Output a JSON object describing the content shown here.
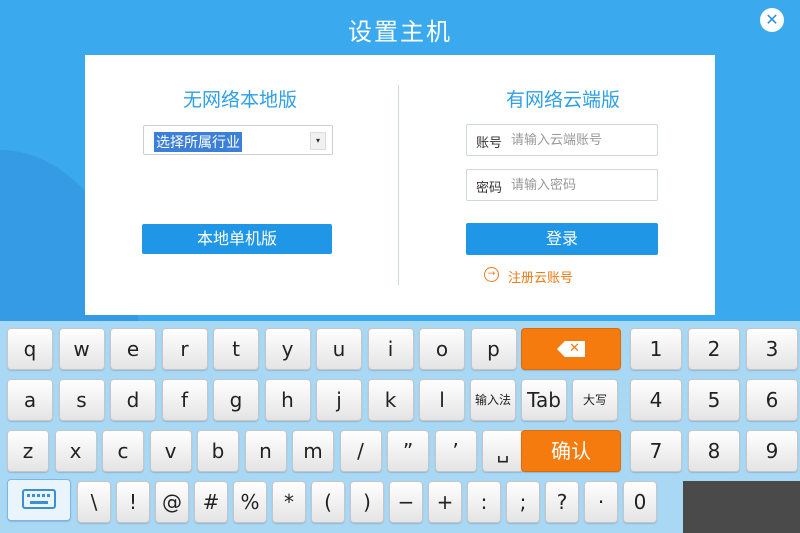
{
  "title": "设置主机",
  "left": {
    "heading": "无网络本地版",
    "industry_select": "选择所属行业",
    "local_button": "本地单机版"
  },
  "right": {
    "heading": "有网络云端版",
    "account_label": "账号",
    "account_placeholder": "请输入云端账号",
    "password_label": "密码",
    "password_placeholder": "请输入密码",
    "login_button": "登录",
    "register_link": "注册云账号"
  },
  "keyboard": {
    "row1": [
      "q",
      "w",
      "e",
      "r",
      "t",
      "y",
      "u",
      "i",
      "o",
      "p"
    ],
    "row2": [
      "a",
      "s",
      "d",
      "f",
      "g",
      "h",
      "j",
      "k",
      "l"
    ],
    "row2_extra": [
      "输入法",
      "Tab",
      "大写"
    ],
    "row3": [
      "z",
      "x",
      "c",
      "v",
      "b",
      "n",
      "m",
      "/",
      "”",
      "’",
      "␣"
    ],
    "confirm": "确认",
    "row4": [
      "\\",
      "!",
      "@",
      "#",
      "%",
      "*",
      "(",
      ")",
      "−",
      "+",
      ":",
      ";",
      "?",
      "·",
      "0"
    ],
    "numpad": [
      "1",
      "2",
      "3",
      "4",
      "5",
      "6",
      "7",
      "8",
      "9"
    ]
  },
  "colors": {
    "background": "#3aa9ee",
    "accent": "#1f96e6",
    "orange": "#f57b0f"
  },
  "icons": [
    "close-icon",
    "dropdown-arrow-icon",
    "register-arrow-icon",
    "backspace-icon",
    "keyboard-icon"
  ]
}
